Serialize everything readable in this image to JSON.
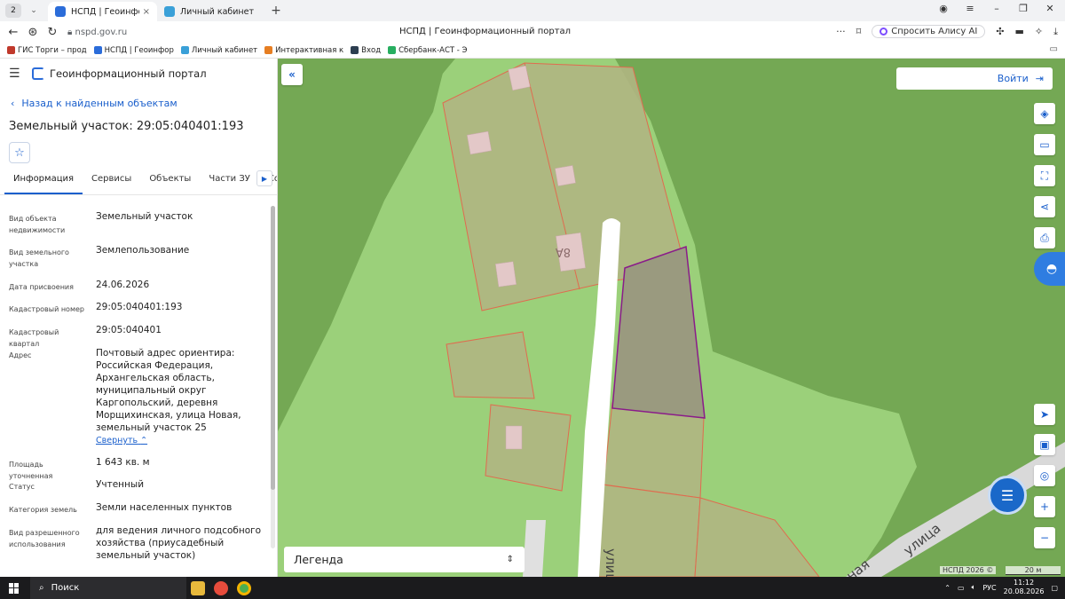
{
  "browser": {
    "tab_counter": "2",
    "tabs": [
      {
        "title": "НСПД | Геоинформаци",
        "favicon_color": "#2b6cd9"
      },
      {
        "title": "Личный кабинет",
        "favicon_color": "#3aa0d8"
      }
    ],
    "url": "nspd.gov.ru",
    "page_title": "НСПД | Геоинформационный портал",
    "alice_label": "Спросить Алису AI",
    "bookmarks": [
      {
        "label": "ГИС Торги – прод",
        "color": "#c0392b"
      },
      {
        "label": "НСПД | Геоинфор",
        "color": "#2b6cd9"
      },
      {
        "label": "Личный кабинет",
        "color": "#3aa0d8"
      },
      {
        "label": "Интерактивная к",
        "color": "#e67e22"
      },
      {
        "label": "Вход",
        "color": "#2c3e50"
      },
      {
        "label": "Сбербанк-АСТ - Э",
        "color": "#27ae60"
      }
    ]
  },
  "panel": {
    "portal_name": "Геоинформационный портал",
    "back_link": "Назад к найденным объектам",
    "title": "Земельный участок: 29:05:040401:193",
    "tabs": [
      "Информация",
      "Сервисы",
      "Объекты",
      "Части ЗУ",
      "Состав"
    ],
    "rows": [
      {
        "label": "Вид объекта недвижимости",
        "value": "Земельный участок"
      },
      {
        "label": "Вид земельного участка",
        "value": "Землепользование"
      },
      {
        "label": "Дата присвоения",
        "value": "24.06.2026"
      },
      {
        "label": "Кадастровый номер",
        "value": "29:05:040401:193"
      },
      {
        "label": "Кадастровый квартал",
        "value": "29:05:040401"
      },
      {
        "label": "Адрес",
        "value": "Почтовый адрес ориентира: Российская Федерация, Архангельская область, муниципальный округ Каргопольский, деревня Морщихинская, улица Новая, земельный участок 25"
      },
      {
        "label": "Площадь уточненная",
        "value": "1 643 кв. м"
      },
      {
        "label": "Статус",
        "value": "Учтенный"
      },
      {
        "label": "Категория земель",
        "value": "Земли населенных пунктов"
      },
      {
        "label": "Вид разрешенного использования",
        "value": "для ведения личного подсобного хозяйства (приусадебный земельный участок)"
      }
    ],
    "collapse_link": "Свернуть"
  },
  "map": {
    "login_label": "Войти",
    "legend_label": "Легенда",
    "house_number": "8А",
    "street_labels": [
      "улица",
      "улица",
      "ная"
    ],
    "attribution": "НСПД 2026 ©",
    "scale_label": "20 м",
    "colors": {
      "forest": "#74a854",
      "field": "#9bd07a",
      "parcel_fill": "#b0b582",
      "parcel_border": "#e06b4f",
      "selected_fill": "#9a9a7f",
      "selected_border": "#8a1b8a",
      "road": "#ffffff",
      "building": "#e3c8c8"
    }
  },
  "taskbar": {
    "search_label": "Поиск",
    "language": "РУС",
    "time": "11:12",
    "date": "20.08.2026"
  }
}
